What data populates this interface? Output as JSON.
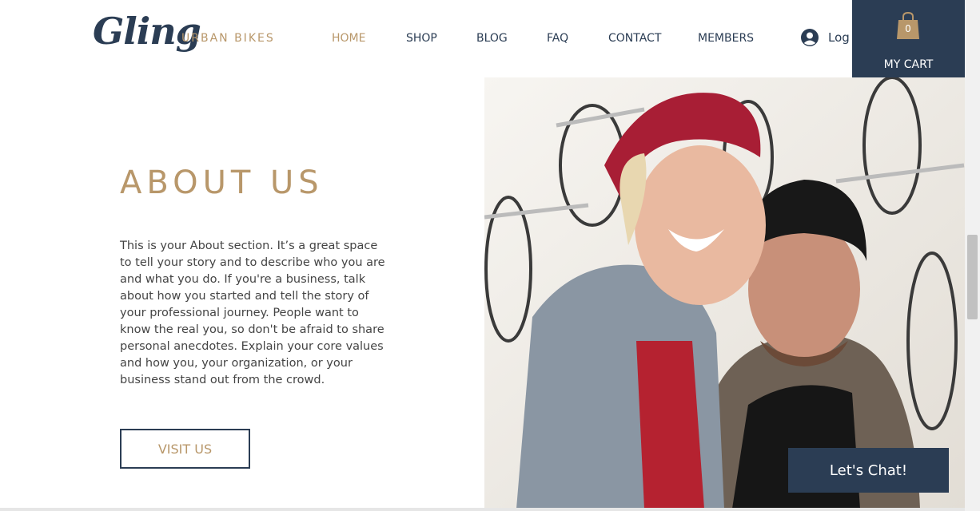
{
  "header": {
    "logo_text": "Gling",
    "tagline": "URBAN BIKES",
    "nav": [
      {
        "label": "HOME",
        "active": true
      },
      {
        "label": "SHOP",
        "active": false
      },
      {
        "label": "BLOG",
        "active": false
      },
      {
        "label": "FAQ",
        "active": false
      },
      {
        "label": "CONTACT",
        "active": false
      },
      {
        "label": "MEMBERS",
        "active": false
      }
    ],
    "login_label": "Log",
    "login_icon": "user-avatar-icon",
    "cart": {
      "count": "0",
      "label": "MY CART",
      "icon": "shopping-bag-icon"
    }
  },
  "about": {
    "title": "ABOUT US",
    "body": "This is your About section. It’s a great space to tell your story and to describe who you are and what you do. If you're a business, talk about how you started and tell the story of your professional journey. People want to know the real you, so don't be afraid to share personal anecdotes. Explain your core values and how you, your organization, or your business stand out from the crowd.",
    "button_label": "VISIT US"
  },
  "chat": {
    "label": "Let's Chat!"
  },
  "colors": {
    "navy": "#2b3d54",
    "gold": "#b8976a",
    "text": "#444444"
  }
}
